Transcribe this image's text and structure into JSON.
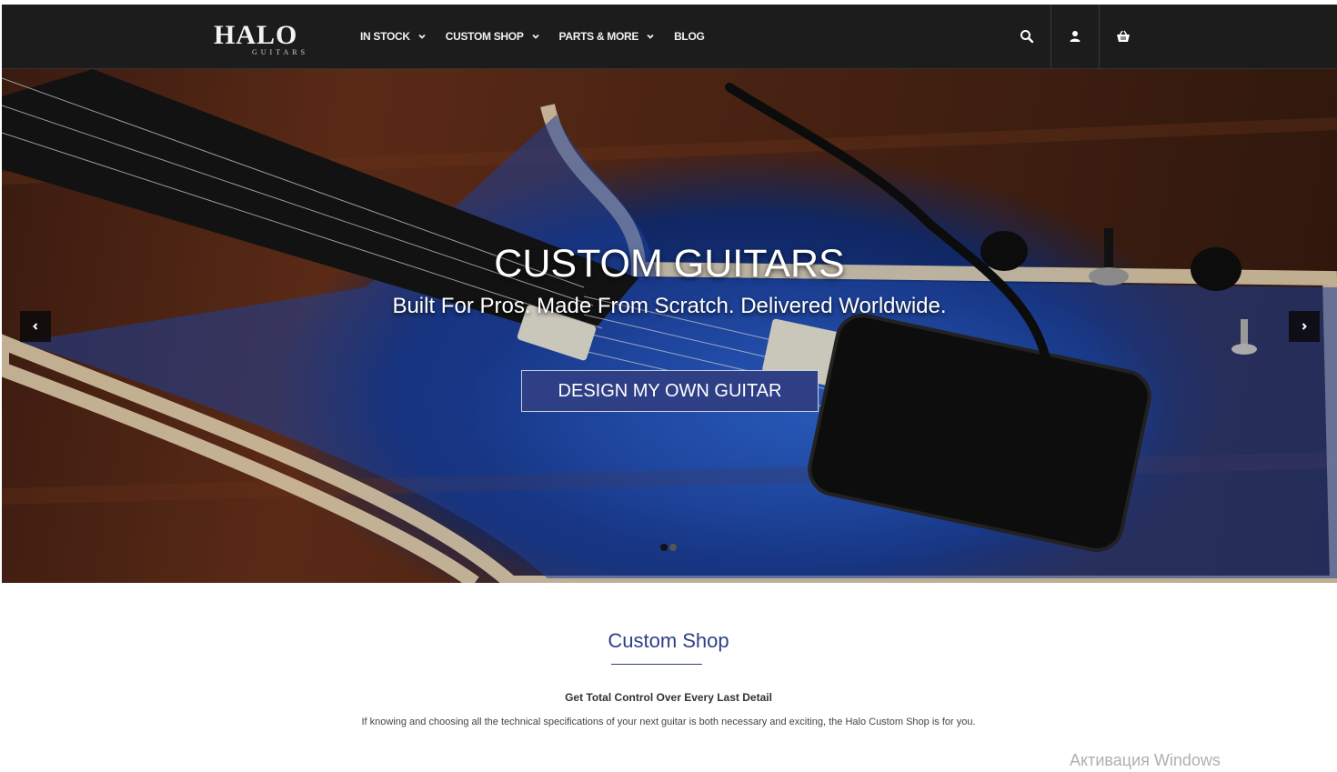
{
  "header": {
    "logo_text": "HALO",
    "logo_sub": "GUITARS",
    "nav": [
      {
        "label": "IN STOCK",
        "has_dropdown": true
      },
      {
        "label": "CUSTOM SHOP",
        "has_dropdown": true
      },
      {
        "label": "PARTS & MORE",
        "has_dropdown": true
      },
      {
        "label": "BLOG",
        "has_dropdown": false
      }
    ],
    "icons": [
      "search-icon",
      "user-icon",
      "cart-icon"
    ]
  },
  "hero": {
    "title": "CUSTOM GUITARS",
    "subtitle": "Built For Pros. Made From Scratch. Delivered Worldwide.",
    "cta_label": "DESIGN MY OWN GUITAR",
    "slides_count": 2,
    "active_slide": 1
  },
  "content": {
    "section_title": "Custom Shop",
    "heading": "Get Total Control Over Every Last Detail",
    "text": "If knowing and choosing all the technical specifications of your next guitar is both necessary and exciting, the Halo Custom Shop is for you."
  },
  "watermark": "Активация Windows",
  "colors": {
    "navbar_bg": "#1c1c1c",
    "accent": "#2e3f85",
    "nav_text": "#f2f2f2"
  }
}
